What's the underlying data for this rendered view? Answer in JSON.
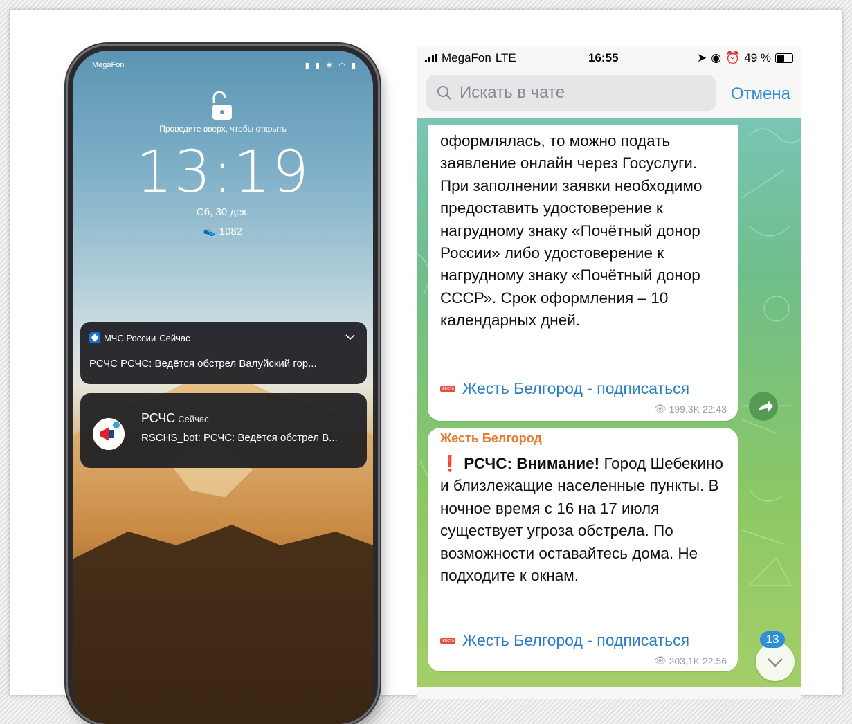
{
  "lockscreen": {
    "carrier": "MegaFon",
    "swipe_hint": "Проведите вверх, чтобы открыть",
    "time": "13:19",
    "date": "Сб, 30 дек.",
    "steps": "1082",
    "notifications": [
      {
        "app": "МЧС России",
        "when": "Сейчас",
        "text": "РСЧС РСЧС: Ведётся обстрел Валуйский гор..."
      },
      {
        "app": "РСЧС",
        "when": "Сейчас",
        "text": "RSCHS_bot: РСЧС: Ведётся обстрел В..."
      }
    ]
  },
  "telegram": {
    "status": {
      "carrier": "MegaFon",
      "network": "LTE",
      "time": "16:55",
      "battery": "49 %"
    },
    "search": {
      "placeholder": "Искать в чате",
      "cancel": "Отмена"
    },
    "messages": [
      {
        "text": "оформлялась, то можно подать заявление онлайн через Госуслуги. При заполнении заявки необходимо предоставить удостоверение к нагрудному знаку «Почётный донор России» либо удостоверение к нагрудному знаку «Почётный донор СССР». Срок оформления – 10 календарных дней.",
        "link": "Жесть Белгород - подписаться",
        "views": "199,3K",
        "time": "22:43"
      },
      {
        "sender": "Жесть Белгород",
        "alert_icon": "❗",
        "lead": "РСЧС: Внимание!",
        "text": " Город Шебекино и близлежащие населенные пункты. В ночное время с 16 на 17 июля существует угроза обстрела. По возможности оставайтесь дома. Не подходите к окнам.",
        "link": "Жесть Белгород - подписаться",
        "views": "203,1K",
        "time": "22:56"
      }
    ],
    "unread_count": "13"
  },
  "colors": {
    "accent": "#2f8ed6",
    "sender": "#e6792b",
    "link": "#2a7fc4"
  }
}
